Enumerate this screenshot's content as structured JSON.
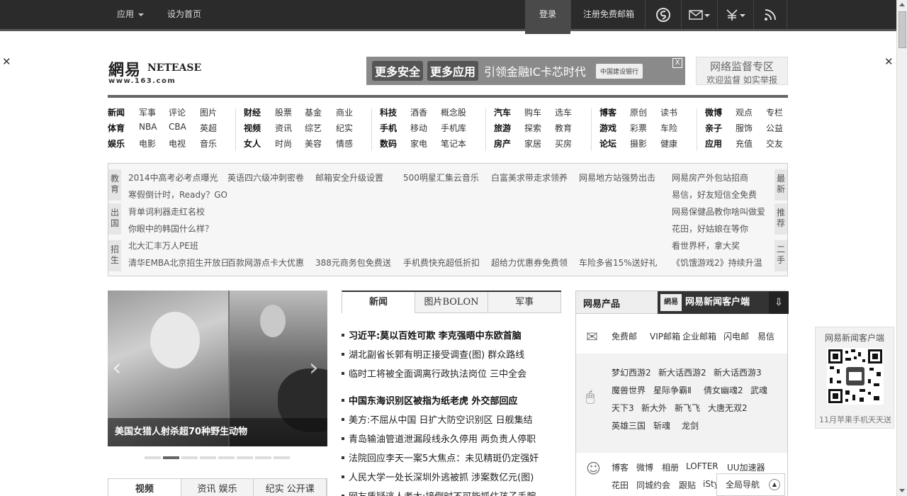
{
  "topbar": {
    "apps": "应用",
    "set_home": "设为首页",
    "login": "登录",
    "register": "注册免费邮箱"
  },
  "logo": {
    "cn": "網易",
    "en": "NETEASE",
    "url": "www.163.com"
  },
  "banner": {
    "text1": "更多安全",
    "text2": "更多应用",
    "text3": "引领金融IC卡芯时代",
    "bank": "中国建设银行",
    "close": "X"
  },
  "report": {
    "title": "网络监督专区",
    "subtitle": "欢迎监督 如实举报"
  },
  "nav": [
    [
      "新闻",
      "军事",
      "评论",
      "图片"
    ],
    [
      "体育",
      "NBA",
      "CBA",
      "英超"
    ],
    [
      "娱乐",
      "电影",
      "电视",
      "音乐"
    ],
    [
      "财经",
      "股票",
      "基金",
      "商业"
    ],
    [
      "视频",
      "资讯",
      "综艺",
      "纪实"
    ],
    [
      "女人",
      "时尚",
      "美容",
      "情感"
    ],
    [
      "科技",
      "酒香",
      "概念股"
    ],
    [
      "手机",
      "移动",
      "手机库"
    ],
    [
      "数码",
      "家电",
      "笔记本"
    ],
    [
      "汽车",
      "购车",
      "选车"
    ],
    [
      "旅游",
      "探索",
      "教育"
    ],
    [
      "房产",
      "家居",
      "买房"
    ],
    [
      "博客",
      "原创",
      "读书"
    ],
    [
      "游戏",
      "彩票",
      "车险"
    ],
    [
      "论坛",
      "摄影",
      "健康"
    ],
    [
      "微博",
      "观点",
      "专栏"
    ],
    [
      "亲子",
      "服饰",
      "公益"
    ],
    [
      "应用",
      "充值",
      "交友"
    ]
  ],
  "ads": {
    "side_left": [
      "教育",
      "出国",
      "招生"
    ],
    "side_right": [
      "最新",
      "推荐",
      "二手"
    ],
    "row1": [
      "2014中高考必考点曝光",
      "英语四六级冲刺密卷",
      "邮箱安全升级设置",
      "500明星汇集云音乐",
      "白富美求带走求领养",
      "网易地方站强势出击",
      "网易房产外包站招商"
    ],
    "left_col": [
      "寒假倒计时，Ready？GO",
      "背单词利器走红名校",
      "你眼中的韩国什么样？",
      "北大汇丰万人PE班"
    ],
    "right_col": [
      "易信，好友短信全免费",
      "网易保健品教你啥叫做爱",
      "花田，好姑娘在等你",
      "看世界杯，拿大奖"
    ],
    "row6": [
      "清华EMBA北京招生开放日",
      "百款网游点卡大优惠",
      "388元商务包免费送",
      "手机费快充超低折扣",
      "超给力优惠券免费领",
      "车险多省15%送好礼",
      "《饥饿游戏2》持续升温"
    ]
  },
  "slider": {
    "caption": "美国女猎人射杀超70种野生动物",
    "prev": "‹",
    "next": "›"
  },
  "bottom_tabs": [
    "视频",
    "资讯 娱乐",
    "纪实 公开课"
  ],
  "news_tabs": [
    "新闻",
    "图片BOLON",
    "军事"
  ],
  "news": [
    {
      "text": "习近平:莫以百姓可欺 李克强晤中东欧首脑",
      "bold": true
    },
    {
      "text": "湖北副省长郭有明正接受调查(图) 群众路线",
      "bold": false
    },
    {
      "text": "临时工将被全面调离行政执法岗位 三中全会",
      "bold": false
    },
    {
      "text": "中国东海识别区被指为纸老虎 外交部回应",
      "bold": true
    },
    {
      "text": "美方:不屈从中国 日扩大防空识别区 日舰集结",
      "bold": false
    },
    {
      "text": "青岛输油管道泄漏段线永久停用 两负责人停职",
      "bold": false
    },
    {
      "text": "法院回应李天一案5大焦点：未见精斑仍定强奸",
      "bold": false
    },
    {
      "text": "人民大学一处长深圳外逃被抓 涉案数亿元(图)",
      "bold": false
    },
    {
      "text": "网友质疑逃人者太:接倒时不可能抓住孩子手腕",
      "bold": false
    }
  ],
  "products": {
    "title": "网易产品",
    "app_mini": "網易",
    "app_title": "网易新闻客户端",
    "mail": [
      "免费邮",
      "VIP邮箱",
      "企业邮箱",
      "闪电邮",
      "易信"
    ],
    "games": [
      [
        "梦幻西游2",
        "新大话西游2",
        "新大话西游3"
      ],
      [
        "魔兽世界",
        "星际争霸Ⅱ",
        "倩女幽魂2",
        "武魂"
      ],
      [
        "天下3",
        "新大外",
        "新飞飞",
        "大唐无双2"
      ],
      [
        "英雄三国",
        "斩魂",
        "龙剑"
      ]
    ],
    "social": [
      [
        "博客",
        "微博",
        "相册",
        "LOFTER",
        "UU加速器"
      ],
      [
        "花田",
        "同城约会",
        "跟贴",
        "iSty"
      ]
    ]
  },
  "global_nav": "全局导航",
  "qr": {
    "title": "网易新闻客户端",
    "promo": "11月苹果手机天天送"
  }
}
